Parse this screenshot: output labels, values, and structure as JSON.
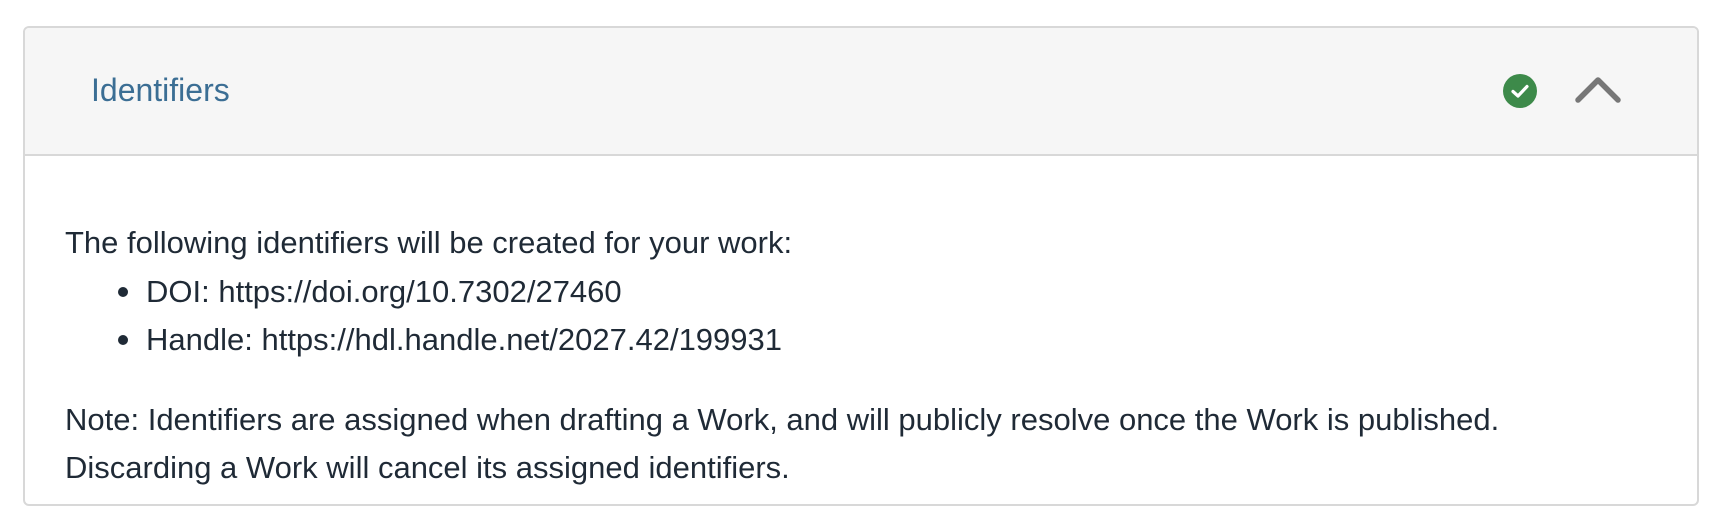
{
  "section": {
    "title": "Identifiers",
    "status_icon": "check-circle-icon",
    "status_color": "#3d8a4a",
    "toggle_icon": "chevron-up-icon",
    "title_color": "#3b6e94"
  },
  "body": {
    "intro": "The following identifiers will be created for your work:",
    "identifiers": [
      {
        "text": "DOI: https://doi.org/10.7302/27460"
      },
      {
        "text": "Handle: https://hdl.handle.net/2027.42/199931"
      }
    ],
    "note_line1": "Note: Identifiers are assigned when drafting a Work, and will publicly resolve once the Work is published.",
    "note_line2": "Discarding a Work will cancel its assigned identifiers."
  }
}
